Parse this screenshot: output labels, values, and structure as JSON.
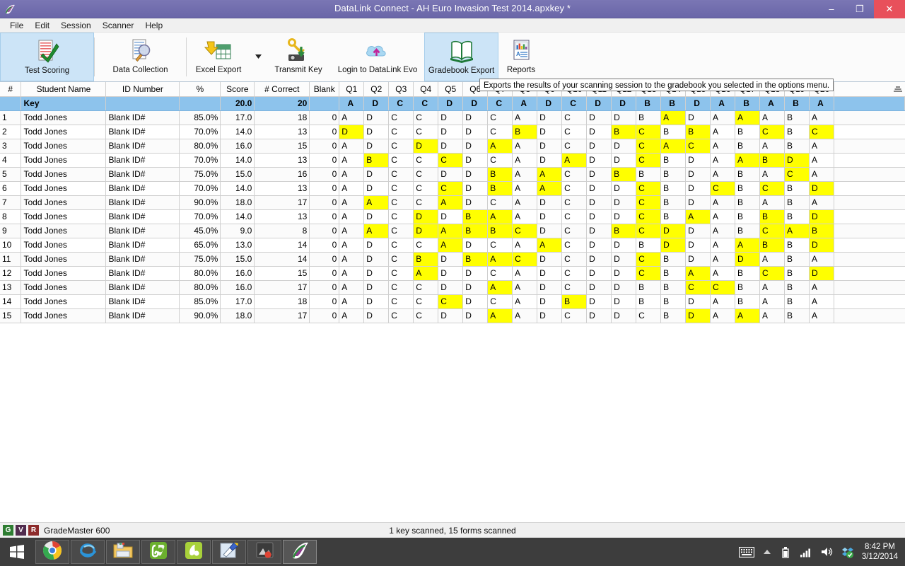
{
  "window": {
    "title": "DataLink Connect - AH Euro Invasion Test 2014.apxkey *",
    "logo_icon": "datalink-logo-icon",
    "minimize_label": "–",
    "maximize_label": "❐",
    "close_label": "✕",
    "accent_title_bg": "#6a66a8",
    "close_bg": "#e8505b"
  },
  "menubar": {
    "items": [
      "File",
      "Edit",
      "Session",
      "Scanner",
      "Help"
    ]
  },
  "toolbar": {
    "buttons": [
      {
        "label": "Test Scoring",
        "icon": "form-checkmark-icon",
        "active": true
      },
      {
        "label": "Data Collection",
        "icon": "form-magnifier-icon",
        "active": false
      },
      {
        "label": "Excel Export",
        "icon": "excel-export-icon",
        "active": false
      },
      {
        "label": "Transmit Key",
        "icon": "transmit-key-icon",
        "active": false
      },
      {
        "label": "Login to DataLink Evo",
        "icon": "cloud-upload-icon",
        "active": false
      },
      {
        "label": "Gradebook Export",
        "icon": "open-book-icon",
        "active": true
      },
      {
        "label": "Reports",
        "icon": "report-chart-icon",
        "active": false
      }
    ],
    "dropdown_icon": "chevron-down-icon"
  },
  "tooltip": {
    "text": "Exports the results of your scanning session to the gradebook you selected in the options menu."
  },
  "grid": {
    "columns": [
      "#",
      "Student Name",
      "ID Number",
      "%",
      "Score",
      "# Correct",
      "Blank",
      "Q1",
      "Q2",
      "Q3",
      "Q4",
      "Q5",
      "Q6",
      "Q7",
      "Q8",
      "Q9",
      "Q10",
      "Q11",
      "Q12",
      "Q13",
      "Q14",
      "Q15",
      "Q16",
      "Q17",
      "Q18",
      "Q19",
      "Q20"
    ],
    "sort_grip_icon": "column-resize-grip-icon",
    "key_row": {
      "num": "",
      "name": "Key",
      "id": "",
      "pct": "",
      "score": "20.0",
      "correct": "20",
      "blank": "",
      "answers": [
        "A",
        "D",
        "C",
        "C",
        "D",
        "D",
        "C",
        "A",
        "D",
        "C",
        "D",
        "D",
        "B",
        "B",
        "D",
        "A",
        "B",
        "A",
        "B",
        "A"
      ]
    },
    "highlight_color": "#ffff00",
    "key_row_color": "#8dc3ec",
    "rows": [
      {
        "num": "1",
        "name": "Todd Jones",
        "id": "Blank ID#",
        "pct": "85.0%",
        "score": "17.0",
        "correct": "18",
        "blank": "0",
        "answers": [
          "A",
          "D",
          "C",
          "C",
          "D",
          "D",
          "C",
          "A",
          "D",
          "C",
          "D",
          "D",
          "B",
          "A",
          "D",
          "A",
          "A",
          "A",
          "B",
          "A"
        ],
        "wrong": [
          13,
          16
        ]
      },
      {
        "num": "2",
        "name": "Todd Jones",
        "id": "Blank ID#",
        "pct": "70.0%",
        "score": "14.0",
        "correct": "13",
        "blank": "0",
        "answers": [
          "D",
          "D",
          "C",
          "C",
          "D",
          "D",
          "C",
          "B",
          "D",
          "C",
          "D",
          "B",
          "C",
          "B",
          "B",
          "A",
          "B",
          "C",
          "B",
          "C"
        ],
        "wrong": [
          0,
          7,
          11,
          12,
          14,
          17,
          19
        ]
      },
      {
        "num": "3",
        "name": "Todd Jones",
        "id": "Blank ID#",
        "pct": "80.0%",
        "score": "16.0",
        "correct": "15",
        "blank": "0",
        "answers": [
          "A",
          "D",
          "C",
          "D",
          "D",
          "D",
          "A",
          "A",
          "D",
          "C",
          "D",
          "D",
          "C",
          "A",
          "C",
          "A",
          "B",
          "A",
          "B",
          "A"
        ],
        "wrong": [
          3,
          6,
          12,
          13,
          14
        ]
      },
      {
        "num": "4",
        "name": "Todd Jones",
        "id": "Blank ID#",
        "pct": "70.0%",
        "score": "14.0",
        "correct": "13",
        "blank": "0",
        "answers": [
          "A",
          "B",
          "C",
          "C",
          "C",
          "D",
          "C",
          "A",
          "D",
          "A",
          "D",
          "D",
          "C",
          "B",
          "D",
          "A",
          "A",
          "B",
          "D",
          "A"
        ],
        "wrong": [
          1,
          4,
          9,
          12,
          16,
          17,
          18
        ]
      },
      {
        "num": "5",
        "name": "Todd Jones",
        "id": "Blank ID#",
        "pct": "75.0%",
        "score": "15.0",
        "correct": "16",
        "blank": "0",
        "answers": [
          "A",
          "D",
          "C",
          "C",
          "D",
          "D",
          "B",
          "A",
          "A",
          "C",
          "D",
          "B",
          "B",
          "B",
          "D",
          "A",
          "B",
          "A",
          "C",
          "A"
        ],
        "wrong": [
          6,
          8,
          11,
          18
        ]
      },
      {
        "num": "6",
        "name": "Todd Jones",
        "id": "Blank ID#",
        "pct": "70.0%",
        "score": "14.0",
        "correct": "13",
        "blank": "0",
        "answers": [
          "A",
          "D",
          "C",
          "C",
          "C",
          "D",
          "B",
          "A",
          "A",
          "C",
          "D",
          "D",
          "C",
          "B",
          "D",
          "C",
          "B",
          "C",
          "B",
          "D"
        ],
        "wrong": [
          4,
          6,
          8,
          12,
          15,
          17,
          19
        ]
      },
      {
        "num": "7",
        "name": "Todd Jones",
        "id": "Blank ID#",
        "pct": "90.0%",
        "score": "18.0",
        "correct": "17",
        "blank": "0",
        "answers": [
          "A",
          "A",
          "C",
          "C",
          "A",
          "D",
          "C",
          "A",
          "D",
          "C",
          "D",
          "D",
          "C",
          "B",
          "D",
          "A",
          "B",
          "A",
          "B",
          "A"
        ],
        "wrong": [
          1,
          4,
          12
        ]
      },
      {
        "num": "8",
        "name": "Todd Jones",
        "id": "Blank ID#",
        "pct": "70.0%",
        "score": "14.0",
        "correct": "13",
        "blank": "0",
        "answers": [
          "A",
          "D",
          "C",
          "D",
          "D",
          "B",
          "A",
          "A",
          "D",
          "C",
          "D",
          "D",
          "C",
          "B",
          "A",
          "A",
          "B",
          "B",
          "B",
          "D"
        ],
        "wrong": [
          3,
          5,
          6,
          12,
          14,
          17,
          19
        ]
      },
      {
        "num": "9",
        "name": "Todd Jones",
        "id": "Blank ID#",
        "pct": "45.0%",
        "score": "9.0",
        "correct": "8",
        "blank": "0",
        "answers": [
          "A",
          "A",
          "C",
          "D",
          "A",
          "B",
          "B",
          "C",
          "D",
          "C",
          "D",
          "B",
          "C",
          "D",
          "D",
          "A",
          "B",
          "C",
          "A",
          "B"
        ],
        "wrong": [
          1,
          3,
          4,
          5,
          6,
          7,
          11,
          12,
          13,
          17,
          18,
          19
        ]
      },
      {
        "num": "10",
        "name": "Todd Jones",
        "id": "Blank ID#",
        "pct": "65.0%",
        "score": "13.0",
        "correct": "14",
        "blank": "0",
        "answers": [
          "A",
          "D",
          "C",
          "C",
          "A",
          "D",
          "C",
          "A",
          "A",
          "C",
          "D",
          "D",
          "B",
          "D",
          "D",
          "A",
          "A",
          "B",
          "B",
          "D"
        ],
        "wrong": [
          4,
          8,
          13,
          16,
          17,
          19
        ]
      },
      {
        "num": "11",
        "name": "Todd Jones",
        "id": "Blank ID#",
        "pct": "75.0%",
        "score": "15.0",
        "correct": "14",
        "blank": "0",
        "answers": [
          "A",
          "D",
          "C",
          "B",
          "D",
          "B",
          "A",
          "C",
          "D",
          "C",
          "D",
          "D",
          "C",
          "B",
          "D",
          "A",
          "D",
          "A",
          "B",
          "A"
        ],
        "wrong": [
          3,
          5,
          6,
          7,
          12,
          16
        ]
      },
      {
        "num": "12",
        "name": "Todd Jones",
        "id": "Blank ID#",
        "pct": "80.0%",
        "score": "16.0",
        "correct": "15",
        "blank": "0",
        "answers": [
          "A",
          "D",
          "C",
          "A",
          "D",
          "D",
          "C",
          "A",
          "D",
          "C",
          "D",
          "D",
          "C",
          "B",
          "A",
          "A",
          "B",
          "C",
          "B",
          "D"
        ],
        "wrong": [
          3,
          12,
          14,
          17,
          19
        ]
      },
      {
        "num": "13",
        "name": "Todd Jones",
        "id": "Blank ID#",
        "pct": "80.0%",
        "score": "16.0",
        "correct": "17",
        "blank": "0",
        "answers": [
          "A",
          "D",
          "C",
          "C",
          "D",
          "D",
          "A",
          "A",
          "D",
          "C",
          "D",
          "D",
          "B",
          "B",
          "C",
          "C",
          "B",
          "A",
          "B",
          "A"
        ],
        "wrong": [
          6,
          14,
          15
        ]
      },
      {
        "num": "14",
        "name": "Todd Jones",
        "id": "Blank ID#",
        "pct": "85.0%",
        "score": "17.0",
        "correct": "18",
        "blank": "0",
        "answers": [
          "A",
          "D",
          "C",
          "C",
          "C",
          "D",
          "C",
          "A",
          "D",
          "B",
          "D",
          "D",
          "B",
          "B",
          "D",
          "A",
          "B",
          "A",
          "B",
          "A"
        ],
        "wrong": [
          4,
          9
        ]
      },
      {
        "num": "15",
        "name": "Todd Jones",
        "id": "Blank ID#",
        "pct": "90.0%",
        "score": "18.0",
        "correct": "17",
        "blank": "0",
        "answers": [
          "A",
          "D",
          "C",
          "C",
          "D",
          "D",
          "A",
          "A",
          "D",
          "C",
          "D",
          "D",
          "C",
          "B",
          "D",
          "A",
          "A",
          "A",
          "B",
          "A"
        ],
        "wrong": [
          6,
          14,
          16
        ]
      }
    ]
  },
  "statusbar": {
    "badges": [
      "G",
      "V",
      "R"
    ],
    "device": "GradeMaster 600",
    "scanned": "1 key scanned, 15 forms scanned"
  },
  "taskbar": {
    "start_icon": "windows-start-icon",
    "items": [
      {
        "icon": "chrome-icon",
        "state": "open"
      },
      {
        "icon": "internet-explorer-icon",
        "state": "open"
      },
      {
        "icon": "file-explorer-icon",
        "state": "open"
      },
      {
        "icon": "evernote-icon",
        "state": "open"
      },
      {
        "icon": "screencast-o-matic-icon",
        "state": "open"
      },
      {
        "icon": "snipping-tool-icon",
        "state": "open"
      },
      {
        "icon": "photo-app-icon",
        "state": "open"
      },
      {
        "icon": "datalink-connect-icon",
        "state": "active"
      }
    ],
    "tray": [
      "keyboard-icon",
      "show-hidden-icons-icon",
      "battery-icon",
      "network-signal-icon",
      "volume-icon",
      "dropbox-icon"
    ],
    "time": "8:42 PM",
    "date": "3/12/2014"
  }
}
